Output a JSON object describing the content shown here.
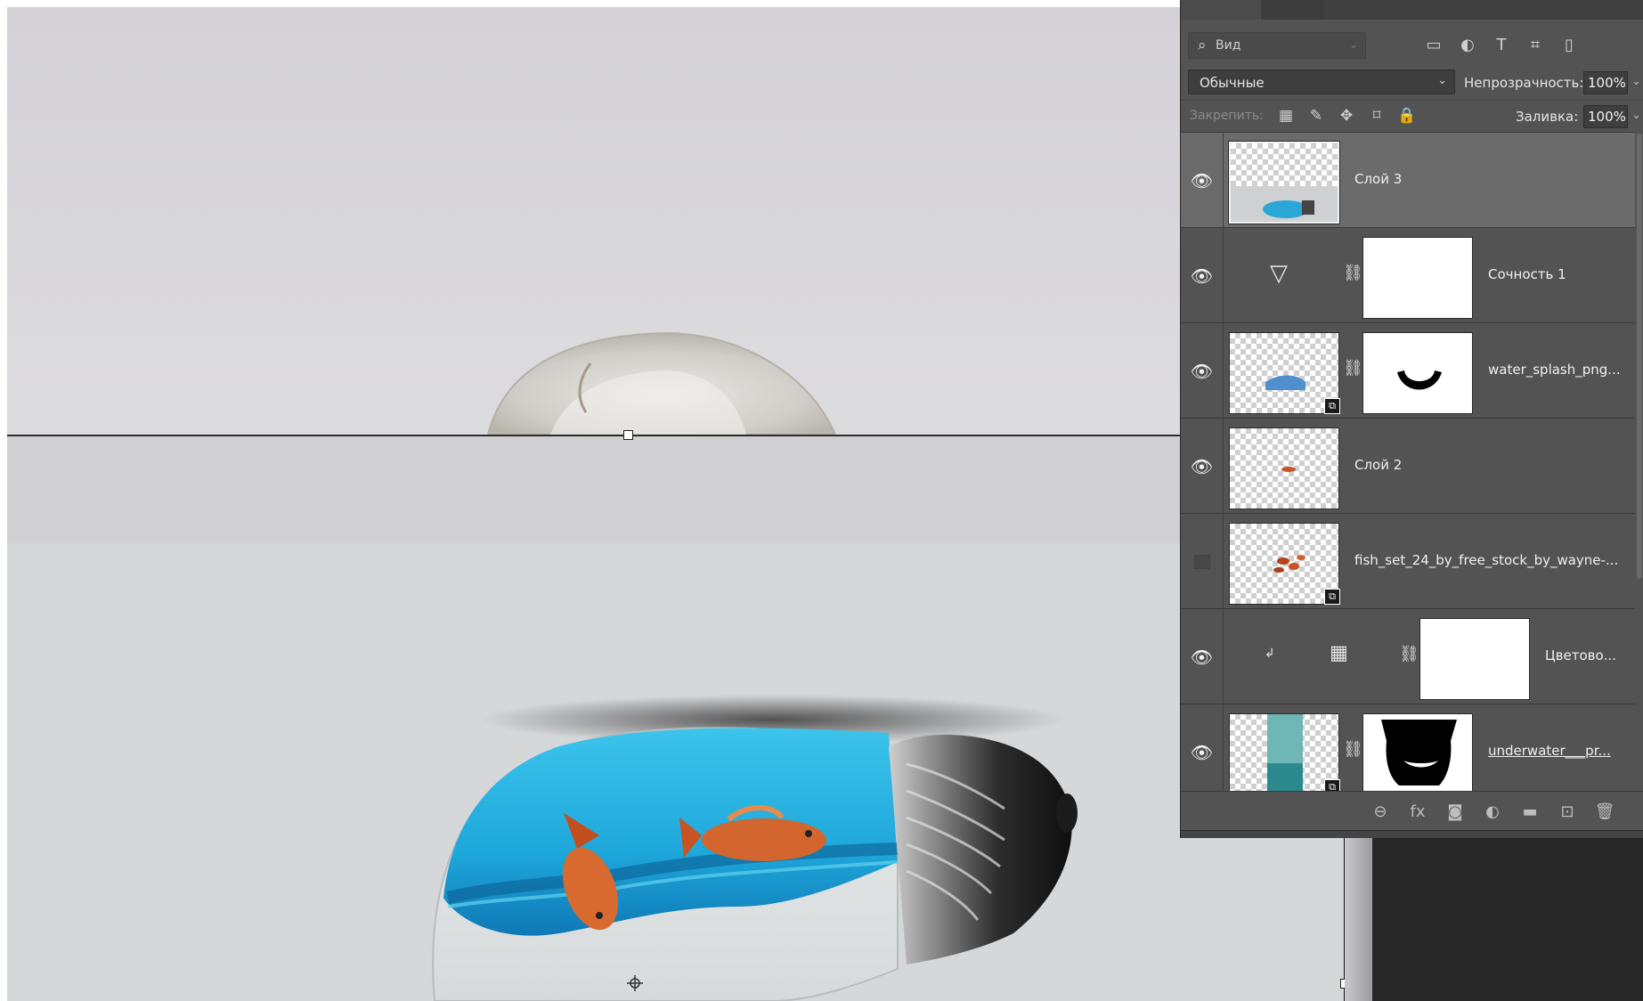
{
  "layers_panel": {
    "filter": {
      "search_icon": "search-icon",
      "label": "Вид"
    },
    "filter_icons": [
      "image-filter-icon",
      "adjustment-filter-icon",
      "type-filter-icon",
      "shape-filter-icon",
      "smart-object-filter-icon"
    ],
    "filter_icon_glyphs": [
      "▭",
      "◐",
      "T",
      "⌗",
      "▯"
    ],
    "blend_mode": "Обычные",
    "opacity_label": "Непрозрачность:",
    "opacity_value": "100%",
    "lock_label": "Закрепить:",
    "lock_icons": [
      "lock-transparent-icon",
      "lock-image-icon",
      "lock-position-icon",
      "lock-artboard-icon",
      "lock-all-icon"
    ],
    "lock_icon_glyphs": [
      "▦",
      "✎",
      "✥",
      "⌑",
      "🔒"
    ],
    "fill_label": "Заливка:",
    "fill_value": "100%",
    "layers": [
      {
        "name": "Слой 3",
        "visible": true,
        "selected": true,
        "type": "pixel"
      },
      {
        "name": "Сочность 1",
        "visible": true,
        "selected": false,
        "type": "adjustment"
      },
      {
        "name": "water_splash_png...",
        "visible": true,
        "selected": false,
        "type": "smart-with-mask"
      },
      {
        "name": "Слой 2",
        "visible": true,
        "selected": false,
        "type": "pixel"
      },
      {
        "name": "fish_set_24_by_free_stock_by_wayne-...",
        "visible": false,
        "selected": false,
        "type": "smart"
      },
      {
        "name": "Цветово...",
        "visible": true,
        "selected": false,
        "type": "adjustment-clipped"
      },
      {
        "name": "underwater___pr...",
        "visible": true,
        "selected": false,
        "type": "smart-with-mask"
      }
    ],
    "footer_icons": [
      "link-layers-icon",
      "fx-icon",
      "add-mask-icon",
      "new-adjustment-icon",
      "new-group-icon",
      "new-layer-icon",
      "trash-icon"
    ],
    "footer_icon_glyphs": [
      "⊖",
      "fx",
      "◙",
      "◐",
      "▬",
      "⊡",
      "🗑"
    ]
  },
  "colors": {
    "panel_bg": "#535353",
    "selected_row": "#6b6b6b",
    "water_blue": "#22a9d8"
  }
}
